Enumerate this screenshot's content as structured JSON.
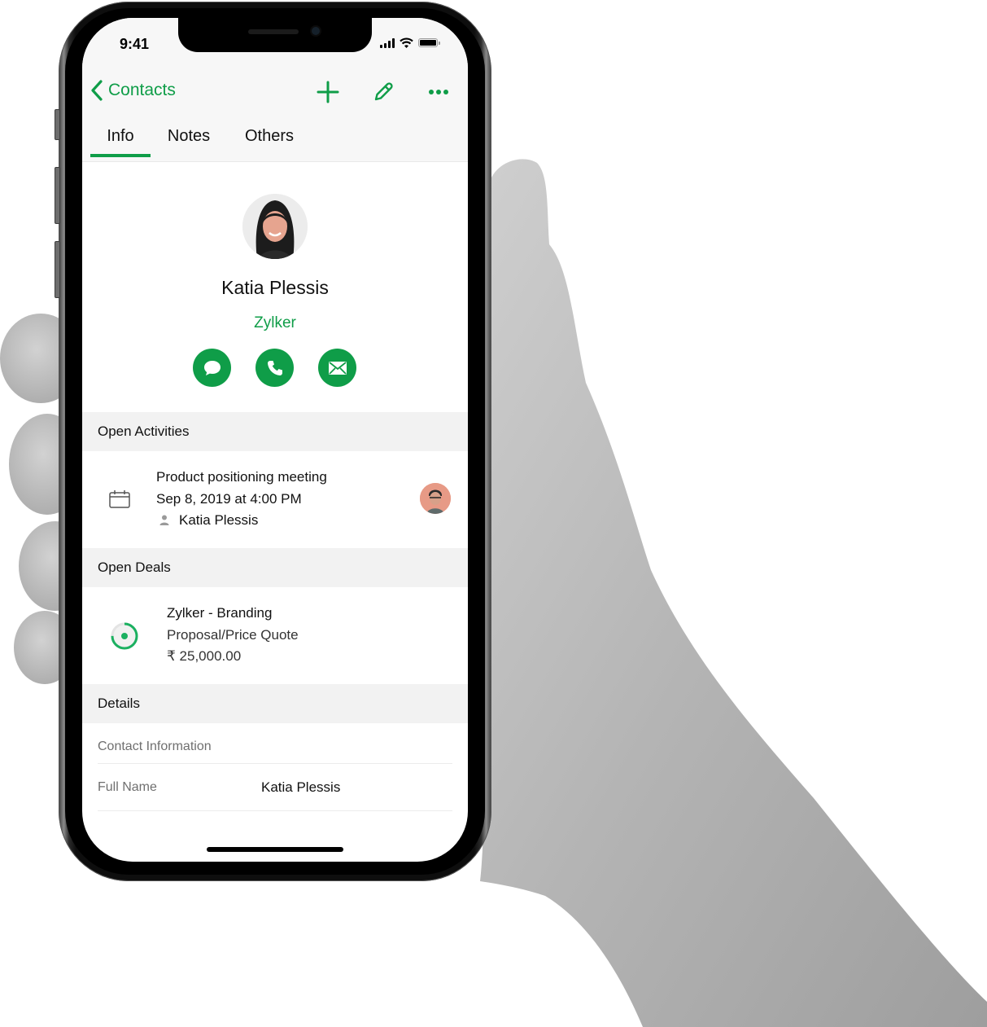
{
  "status_bar": {
    "time": "9:41",
    "signal_icon": "cellular-signal-icon",
    "wifi_icon": "wifi-icon",
    "battery_icon": "battery-icon"
  },
  "nav": {
    "back_label": "Contacts",
    "back_icon": "chevron-left-icon",
    "actions": [
      {
        "name": "add",
        "icon": "plus-icon"
      },
      {
        "name": "edit",
        "icon": "pencil-icon"
      },
      {
        "name": "more",
        "icon": "more-horizontal-icon"
      }
    ]
  },
  "tabs": [
    {
      "label": "Info",
      "active": true
    },
    {
      "label": "Notes",
      "active": false
    },
    {
      "label": "Others",
      "active": false
    }
  ],
  "profile": {
    "name": "Katia Plessis",
    "company": "Zylker",
    "quick_actions": [
      {
        "name": "message",
        "icon": "chat-bubble-icon"
      },
      {
        "name": "call",
        "icon": "phone-icon"
      },
      {
        "name": "email",
        "icon": "envelope-icon"
      }
    ]
  },
  "open_activities": {
    "title": "Open Activities",
    "items": [
      {
        "icon": "calendar-icon",
        "title": "Product positioning meeting",
        "datetime": "Sep 8, 2019 at 4:00 PM",
        "participant": "Katia Plessis",
        "participant_icon": "person-icon",
        "owner_avatar": "owner-avatar"
      }
    ]
  },
  "open_deals": {
    "title": "Open Deals",
    "items": [
      {
        "icon": "deal-stage-progress-icon",
        "stage_progress": 0.75,
        "name": "Zylker - Branding",
        "stage": "Proposal/Price Quote",
        "amount": "₹ 25,000.00"
      }
    ]
  },
  "details": {
    "title": "Details",
    "subsection": "Contact Information",
    "fields": [
      {
        "label": "Full Name",
        "value": "Katia Plessis"
      }
    ]
  },
  "colors": {
    "accent": "#0f9d48",
    "header_bg": "#f7f7f7",
    "section_bg": "#f2f2f2",
    "text": "#111111",
    "muted": "#6f6f6f"
  }
}
